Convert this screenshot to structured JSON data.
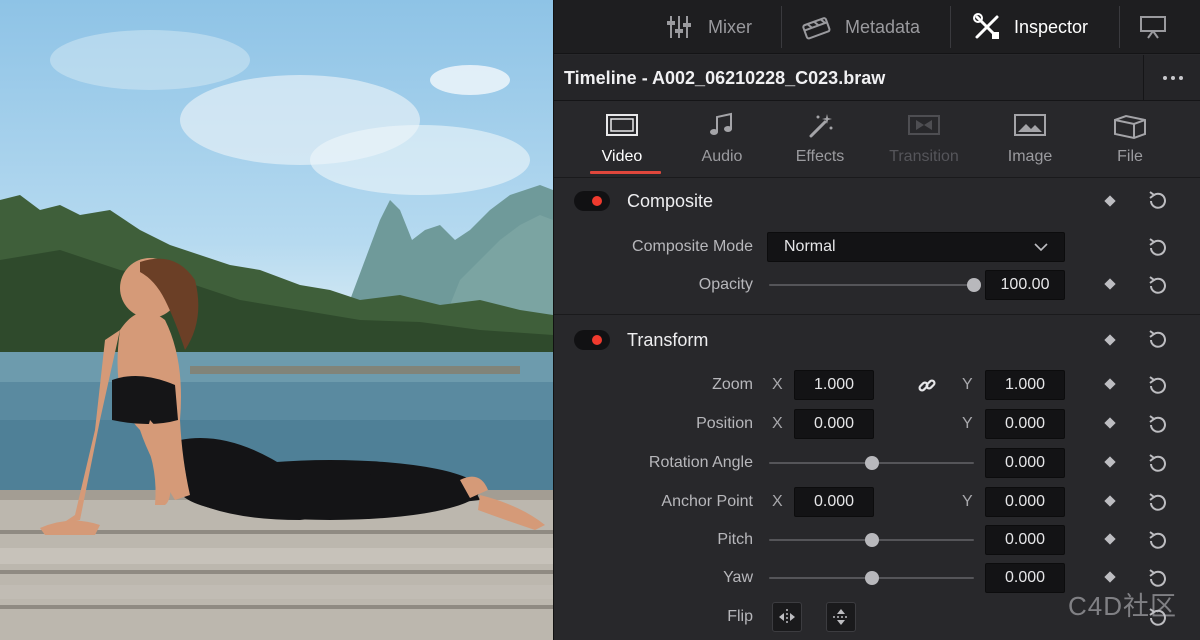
{
  "viewer": {
    "image": "yoga-woman-cobra-pose-on-dock-lake-mountains"
  },
  "toolbar": {
    "items": [
      {
        "label": "Mixer",
        "icon": "mixer-icon"
      },
      {
        "label": "Metadata",
        "icon": "metadata-icon"
      },
      {
        "label": "Inspector",
        "icon": "inspector-icon",
        "active": true
      },
      {
        "label": "",
        "icon": "monitor-icon"
      }
    ]
  },
  "header": {
    "title": "Timeline - A002_06210228_C023.braw",
    "more_icon": "more-dots-icon"
  },
  "tabs": [
    {
      "label": "Video",
      "icon": "video-icon",
      "state": "active"
    },
    {
      "label": "Audio",
      "icon": "audio-icon",
      "state": "normal"
    },
    {
      "label": "Effects",
      "icon": "effects-icon",
      "state": "normal"
    },
    {
      "label": "Transition",
      "icon": "transition-icon",
      "state": "disabled"
    },
    {
      "label": "Image",
      "icon": "image-icon",
      "state": "normal"
    },
    {
      "label": "File",
      "icon": "file-icon",
      "state": "normal"
    }
  ],
  "composite": {
    "title": "Composite",
    "mode_label": "Composite Mode",
    "mode_value": "Normal",
    "opacity_label": "Opacity",
    "opacity_value": "100.00",
    "opacity_slider": 1.0
  },
  "transform": {
    "title": "Transform",
    "zoom": {
      "label": "Zoom",
      "x_axis": "X",
      "x": "1.000",
      "y_axis": "Y",
      "y": "1.000"
    },
    "position": {
      "label": "Position",
      "x_axis": "X",
      "x": "0.000",
      "y_axis": "Y",
      "y": "0.000"
    },
    "rotation": {
      "label": "Rotation Angle",
      "value": "0.000",
      "slider": 0.5
    },
    "anchor": {
      "label": "Anchor Point",
      "x_axis": "X",
      "x": "0.000",
      "y_axis": "Y",
      "y": "0.000"
    },
    "pitch": {
      "label": "Pitch",
      "value": "0.000",
      "slider": 0.5
    },
    "yaw": {
      "label": "Yaw",
      "value": "0.000",
      "slider": 0.5
    },
    "flip": {
      "label": "Flip"
    }
  },
  "watermark": "C4D社区",
  "colors": {
    "accent": "#e0473c",
    "toggle_on": "#f03a2e",
    "panel": "#28282b",
    "field": "#131315"
  }
}
